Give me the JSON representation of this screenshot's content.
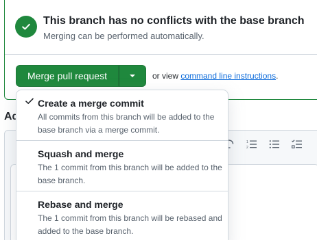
{
  "merge_status": {
    "title": "This branch has no conflicts with the base branch",
    "subtitle": "Merging can be performed automatically.",
    "icon": "check-circle-icon"
  },
  "merge_button": {
    "label": "Merge pull request",
    "dropdown_icon": "triangle-down-icon"
  },
  "cli_hint": {
    "prefix": "or view ",
    "link_text": "command line instructions",
    "suffix": "."
  },
  "comment_section": {
    "heading_visible": "Ad",
    "toolbar_icons": [
      "mention-icon",
      "ordered-list-icon",
      "unordered-list-icon",
      "task-list-icon"
    ]
  },
  "merge_menu": {
    "items": [
      {
        "title": "Create a merge commit",
        "description": "All commits from this branch will be added to the base branch via a merge commit.",
        "selected": true
      },
      {
        "title": "Squash and merge",
        "description": "The 1 commit from this branch will be added to the base branch.",
        "selected": false
      },
      {
        "title": "Rebase and merge",
        "description": "The 1 commit from this branch will be rebased and added to the base branch.",
        "selected": false
      }
    ]
  },
  "colors": {
    "success": "#1f883d",
    "link": "#0969da",
    "border": "#d0d7de",
    "muted_text": "#59636e"
  }
}
